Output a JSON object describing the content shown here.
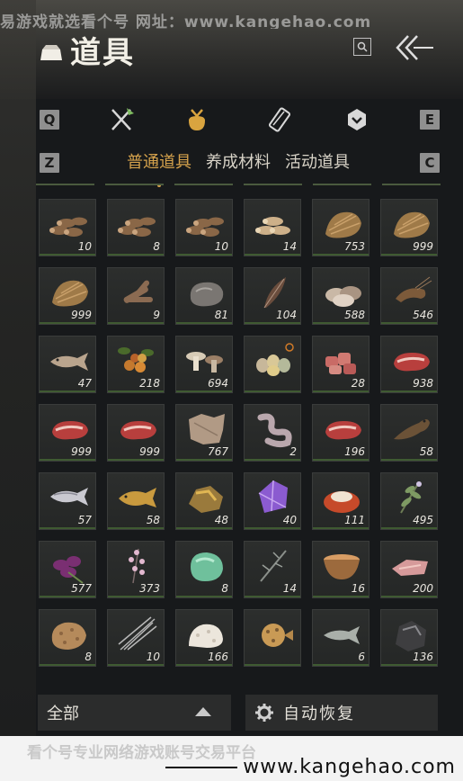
{
  "watermark_top": "易游戏就选看个号  网址：www.kangehao.com",
  "header": {
    "title": "道具"
  },
  "keys": {
    "q": "Q",
    "e": "E",
    "z": "Z",
    "c": "C"
  },
  "category_tabs": [
    "swords-icon",
    "pouch-icon",
    "scroll-icon",
    "badge-icon"
  ],
  "sub_tabs": {
    "general": "普通道具",
    "materials": "养成材料",
    "event": "活动道具"
  },
  "items": [
    {
      "icon": "logs-icon",
      "qty": "10"
    },
    {
      "icon": "logs-icon",
      "qty": "8"
    },
    {
      "icon": "logs-icon",
      "qty": "10"
    },
    {
      "icon": "logs-light-icon",
      "qty": "14"
    },
    {
      "icon": "straw-icon",
      "qty": "753"
    },
    {
      "icon": "straw-icon",
      "qty": "999"
    },
    {
      "icon": "straw-icon",
      "qty": "999"
    },
    {
      "icon": "firewood-icon",
      "qty": "9"
    },
    {
      "icon": "stone-icon",
      "qty": "81"
    },
    {
      "icon": "feather-icon",
      "qty": "104"
    },
    {
      "icon": "shells-icon",
      "qty": "588"
    },
    {
      "icon": "shrimp-icon",
      "qty": "546"
    },
    {
      "icon": "fish-icon",
      "qty": "47"
    },
    {
      "icon": "berries-icon",
      "qty": "218"
    },
    {
      "icon": "mushrooms-icon",
      "qty": "694"
    },
    {
      "icon": "eggs-icon",
      "qty": ""
    },
    {
      "icon": "meat-chunks-icon",
      "qty": "28"
    },
    {
      "icon": "steak-icon",
      "qty": "938"
    },
    {
      "icon": "steak-icon",
      "qty": "999"
    },
    {
      "icon": "steak-icon",
      "qty": "999"
    },
    {
      "icon": "hide-icon",
      "qty": "767"
    },
    {
      "icon": "intestine-icon",
      "qty": "2"
    },
    {
      "icon": "steak-icon",
      "qty": "196"
    },
    {
      "icon": "catfish-icon",
      "qty": "58"
    },
    {
      "icon": "salmon-icon",
      "qty": "57"
    },
    {
      "icon": "carp-icon",
      "qty": "58"
    },
    {
      "icon": "ore-icon",
      "qty": "48"
    },
    {
      "icon": "crystal-icon",
      "qty": "40"
    },
    {
      "icon": "jam-icon",
      "qty": "111"
    },
    {
      "icon": "herb-icon",
      "qty": "495"
    },
    {
      "icon": "flower-icon",
      "qty": "577"
    },
    {
      "icon": "blossom-icon",
      "qty": "373"
    },
    {
      "icon": "jade-icon",
      "qty": "8"
    },
    {
      "icon": "twig-icon",
      "qty": "14"
    },
    {
      "icon": "bowl-icon",
      "qty": "16"
    },
    {
      "icon": "fillet-icon",
      "qty": "200"
    },
    {
      "icon": "sponge-icon",
      "qty": "8"
    },
    {
      "icon": "quills-icon",
      "qty": "10"
    },
    {
      "icon": "coral-icon",
      "qty": "166"
    },
    {
      "icon": "pufferfish-icon",
      "qty": ""
    },
    {
      "icon": "small-fish-icon",
      "qty": "6"
    },
    {
      "icon": "coal-icon",
      "qty": "136"
    }
  ],
  "filter": {
    "label": "全部"
  },
  "restore": {
    "label": "自动恢复"
  },
  "bottom_watermark": "看个号专业网络游戏账号交易平台",
  "bottom_url": "www.kangehao.com",
  "colors": {
    "accent": "#d5a24c",
    "qty_text": "#e9e6df",
    "background": "#17191b"
  }
}
